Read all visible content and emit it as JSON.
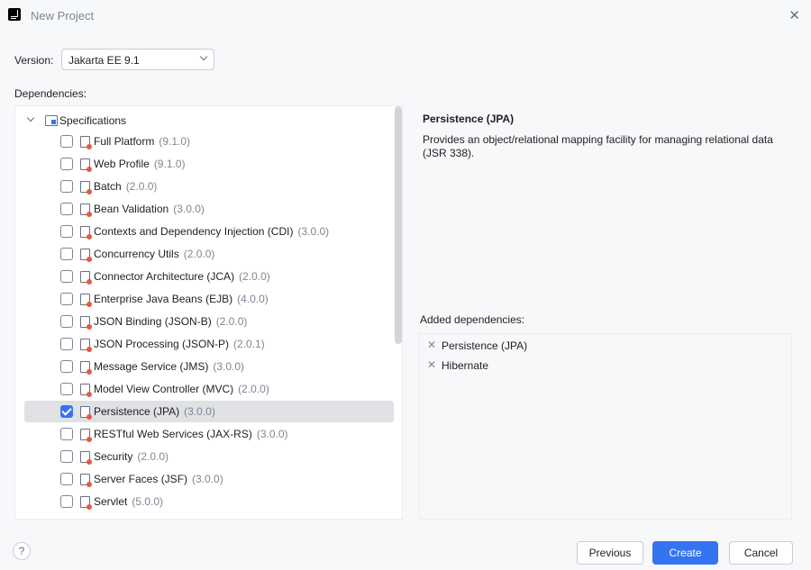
{
  "window": {
    "title": "New Project"
  },
  "version": {
    "label": "Version:",
    "value": "Jakarta EE 9.1"
  },
  "dependencies": {
    "label": "Dependencies:",
    "root": "Specifications",
    "items": [
      {
        "name": "Full Platform",
        "version": "(9.1.0)",
        "checked": false,
        "icon": "platform-icon"
      },
      {
        "name": "Web Profile",
        "version": "(9.1.0)",
        "checked": false,
        "icon": "web-profile-icon"
      },
      {
        "name": "Batch",
        "version": "(2.0.0)",
        "checked": false,
        "icon": "spec-icon"
      },
      {
        "name": "Bean Validation",
        "version": "(3.0.0)",
        "checked": false,
        "icon": "spec-icon"
      },
      {
        "name": "Contexts and Dependency Injection (CDI)",
        "version": "(3.0.0)",
        "checked": false,
        "icon": "spec-icon"
      },
      {
        "name": "Concurrency Utils",
        "version": "(2.0.0)",
        "checked": false,
        "icon": "spec-icon"
      },
      {
        "name": "Connector Architecture (JCA)",
        "version": "(2.0.0)",
        "checked": false,
        "icon": "spec-icon"
      },
      {
        "name": "Enterprise Java Beans (EJB)",
        "version": "(4.0.0)",
        "checked": false,
        "icon": "spec-icon"
      },
      {
        "name": "JSON Binding (JSON-B)",
        "version": "(2.0.0)",
        "checked": false,
        "icon": "spec-icon"
      },
      {
        "name": "JSON Processing (JSON-P)",
        "version": "(2.0.1)",
        "checked": false,
        "icon": "spec-icon"
      },
      {
        "name": "Message Service (JMS)",
        "version": "(3.0.0)",
        "checked": false,
        "icon": "spec-icon"
      },
      {
        "name": "Model View Controller (MVC)",
        "version": "(2.0.0)",
        "checked": false,
        "icon": "spec-icon"
      },
      {
        "name": "Persistence (JPA)",
        "version": "(3.0.0)",
        "checked": true,
        "selected": true,
        "icon": "spec-icon"
      },
      {
        "name": "RESTful Web Services (JAX-RS)",
        "version": "(3.0.0)",
        "checked": false,
        "icon": "spec-icon"
      },
      {
        "name": "Security",
        "version": "(2.0.0)",
        "checked": false,
        "icon": "spec-icon"
      },
      {
        "name": "Server Faces (JSF)",
        "version": "(3.0.0)",
        "checked": false,
        "icon": "spec-icon"
      },
      {
        "name": "Servlet",
        "version": "(5.0.0)",
        "checked": false,
        "icon": "spec-icon"
      }
    ]
  },
  "description": {
    "title": "Persistence (JPA)",
    "text": "Provides an object/relational mapping facility for managing relational data (JSR 338)."
  },
  "added": {
    "label": "Added dependencies:",
    "items": [
      "Persistence (JPA)",
      "Hibernate"
    ],
    "remove_symbol": "✕"
  },
  "footer": {
    "help": "?",
    "previous": "Previous",
    "create": "Create",
    "cancel": "Cancel"
  },
  "colors": {
    "accent": "#3574f0",
    "selection": "#dfe1e5",
    "muted": "#818594"
  }
}
